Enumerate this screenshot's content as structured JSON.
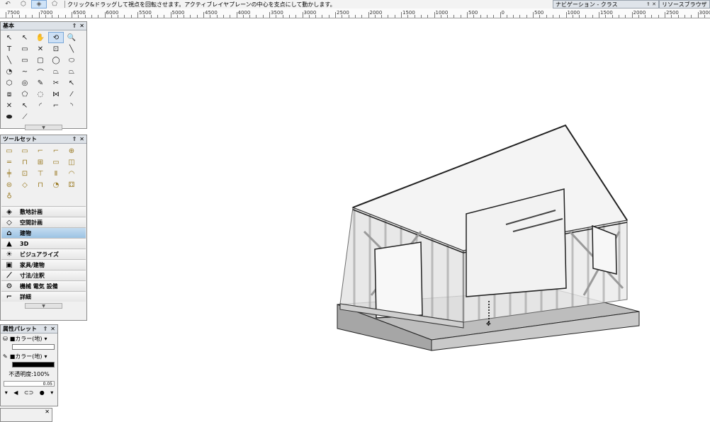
{
  "top_hint": "クリック&ドラッグして視点を回転させます。アクティブレイヤプレーンの中心を支点にして動かします。",
  "top_icons": [
    "rotate-icon",
    "view-cube-icon",
    "flyover-icon",
    "walkthrough-icon"
  ],
  "ruler_labels": [
    "7500",
    "7000",
    "6500",
    "6000",
    "5500",
    "5000",
    "4500",
    "4000",
    "3500",
    "3000",
    "2500",
    "2000",
    "1500",
    "1000",
    "500",
    "0",
    "500",
    "1000",
    "1500",
    "2000",
    "2500",
    "3000"
  ],
  "dock": {
    "nav_title": "ナビゲーション - クラス",
    "nav_ctrls": "⇑ ✕",
    "resource_title": "リソースブラウザ"
  },
  "basic_palette": {
    "title": "基本",
    "ctrls": [
      "⇑",
      "✕"
    ],
    "tools": [
      "↖",
      "↖",
      "✋",
      "⟲",
      "🔍",
      "T",
      "▭",
      "✕",
      "⊡",
      "╲",
      "╲",
      "▭",
      "▢",
      "◯",
      "⬭",
      "◔",
      "∼",
      "⌒",
      "⏢",
      "⏢",
      "⬡",
      "◎",
      "✎",
      "✂",
      "↖",
      "⧈",
      "⬠",
      "◌",
      "⋈",
      "⁄",
      "✕",
      "↖",
      "◜",
      "⌐",
      "◝",
      "⬬",
      "⟋"
    ],
    "active_index": 3
  },
  "toolset_palette": {
    "title": "ツールセット",
    "ctrls": [
      "⇑",
      "✕"
    ],
    "tools": [
      "▭",
      "▭",
      "⌐",
      "⌐",
      "⊕",
      "═",
      "⊓",
      "⊞",
      "▭",
      "◫",
      "╪",
      "⊡",
      "⊤",
      "Ⅱ",
      "◠",
      "⊜",
      "◇",
      "⊓",
      "◔",
      "⚃",
      "♁"
    ],
    "sets": [
      {
        "icon": "◈",
        "label": "敷地計画"
      },
      {
        "icon": "◇",
        "label": "空間計画"
      },
      {
        "icon": "⌂",
        "label": "建物"
      },
      {
        "icon": "▲",
        "label": "3D"
      },
      {
        "icon": "☀",
        "label": "ビジュアライズ"
      },
      {
        "icon": "▣",
        "label": "家具/建物"
      },
      {
        "icon": "⟋",
        "label": "寸法/注釈"
      },
      {
        "icon": "⚙",
        "label": "機械 電気 設備"
      },
      {
        "icon": "⌐",
        "label": "詳細"
      }
    ],
    "active_set": 2
  },
  "attr_palette": {
    "title": "属性パレット",
    "ctrls": [
      "⇑",
      "✕"
    ],
    "fill_label": "■カラー(地)",
    "pen_label": "■カラー(地)",
    "opacity_label": "不透明度:100%",
    "line_weight": "0.05"
  },
  "colors": {
    "accent": "#7aa7d8",
    "active_bg": "#cde0f5",
    "frame": "#6b6b6b",
    "wall": "#d6d6d6"
  }
}
